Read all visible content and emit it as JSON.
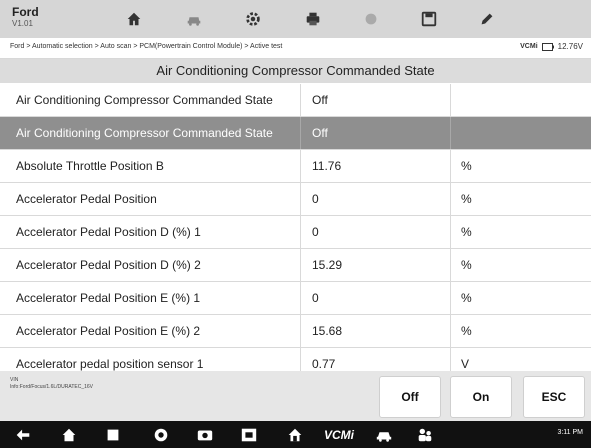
{
  "app": {
    "name": "Ford",
    "version": "V1.01"
  },
  "toolbar": {
    "icons": [
      "home-icon",
      "car-icon",
      "gear-icon",
      "printer-icon",
      "help-icon",
      "save-icon",
      "pen-icon"
    ]
  },
  "breadcrumb": "Ford > Automatic selection > Auto scan > PCM(Powertrain Control Module) > Active test",
  "vcm": {
    "label": "VCMi",
    "voltage": "12.76V"
  },
  "title": "Air Conditioning Compressor Commanded State",
  "rows": [
    {
      "name": "Air Conditioning Compressor Commanded State",
      "value": "Off",
      "unit": ""
    },
    {
      "name": "Air Conditioning Compressor Commanded State",
      "value": "Off",
      "unit": ""
    },
    {
      "name": "Absolute Throttle Position B",
      "value": "11.76",
      "unit": "%"
    },
    {
      "name": "Accelerator Pedal Position",
      "value": "0",
      "unit": "%"
    },
    {
      "name": "Accelerator Pedal Position D (%) 1",
      "value": "0",
      "unit": "%"
    },
    {
      "name": "Accelerator Pedal Position D (%) 2",
      "value": "15.29",
      "unit": "%"
    },
    {
      "name": "Accelerator Pedal Position E (%) 1",
      "value": "0",
      "unit": "%"
    },
    {
      "name": "Accelerator Pedal Position E (%) 2",
      "value": "15.68",
      "unit": "%"
    },
    {
      "name": "Accelerator pedal position sensor 1",
      "value": "0.77",
      "unit": "V"
    }
  ],
  "selected_row": 1,
  "vehicle_info": {
    "line1": "VIN",
    "line2": "Info:Ford/Focus/1.6L/DURATEC_16V"
  },
  "buttons": {
    "off": "Off",
    "on": "On",
    "esc": "ESC"
  },
  "navbar": {
    "vcm_label": "VCMi",
    "status": "3:11 PM"
  },
  "colors": {
    "topbar": "#d6d6d6",
    "title_bg": "#dcdcdc",
    "selected_row": "#8f8f8f",
    "navbar": "#111111"
  }
}
